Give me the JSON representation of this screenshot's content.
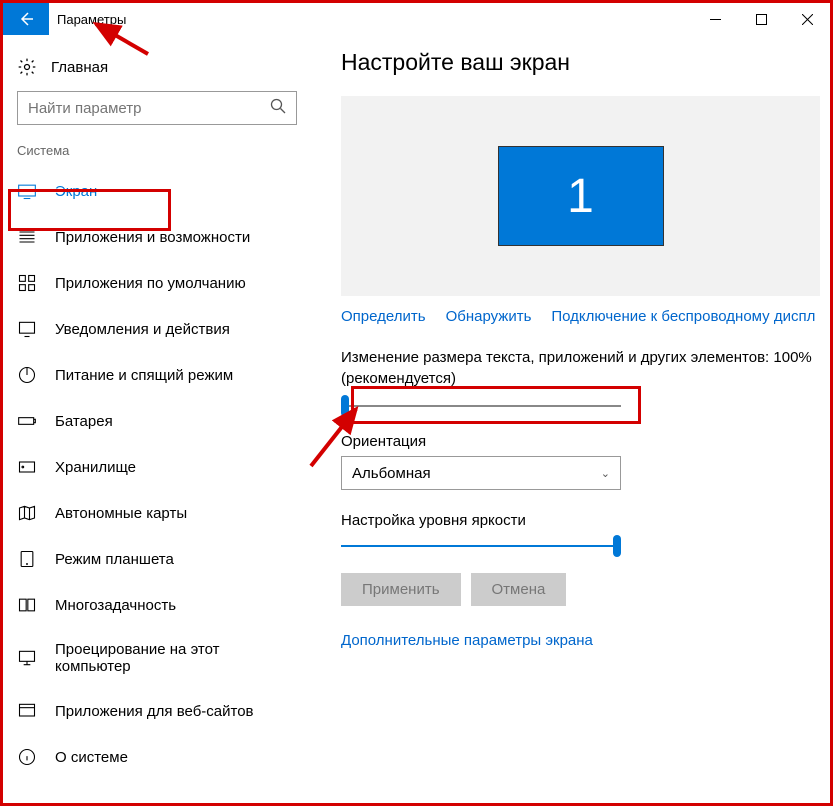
{
  "titlebar": {
    "title": "Параметры"
  },
  "sidebar": {
    "home": "Главная",
    "search_placeholder": "Найти параметр",
    "category": "Система",
    "items": [
      {
        "label": "Экран"
      },
      {
        "label": "Приложения и возможности"
      },
      {
        "label": "Приложения по умолчанию"
      },
      {
        "label": "Уведомления и действия"
      },
      {
        "label": "Питание и спящий режим"
      },
      {
        "label": "Батарея"
      },
      {
        "label": "Хранилище"
      },
      {
        "label": "Автономные карты"
      },
      {
        "label": "Режим планшета"
      },
      {
        "label": "Многозадачность"
      },
      {
        "label": "Проецирование на этот компьютер"
      },
      {
        "label": "Приложения для веб-сайтов"
      },
      {
        "label": "О системе"
      }
    ]
  },
  "main": {
    "title": "Настройте ваш экран",
    "monitor_number": "1",
    "links": {
      "identify": "Определить",
      "detect": "Обнаружить",
      "wireless": "Подключение к беспроводному диспл"
    },
    "scale_text": "Изменение размера текста, приложений и других элементов: 100% (рекомендуется)",
    "orientation_label": "Ориентация",
    "orientation_value": "Альбомная",
    "brightness_label": "Настройка уровня яркости",
    "apply": "Применить",
    "cancel": "Отмена",
    "advanced": "Дополнительные параметры экрана"
  }
}
